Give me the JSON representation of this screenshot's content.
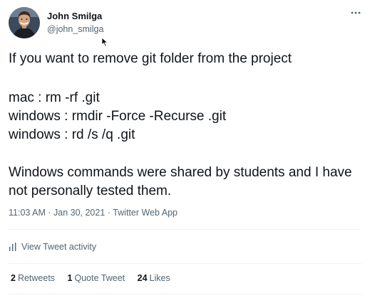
{
  "author": {
    "name": "John Smilga",
    "handle": "@john_smilga",
    "avatar_icon": "profile-photo-icon"
  },
  "tweet": {
    "lines": [
      "If you want to remove git folder from the project",
      "mac :  rm -rf .git",
      "windows :  rmdir -Force -Recurse .git",
      "windows : rd /s /q .git",
      "Windows commands were shared by students and I have",
      "not personally tested them."
    ]
  },
  "meta": {
    "time": "11:03 AM",
    "separator": " · ",
    "date": "Jan 30, 2021",
    "source": "Twitter Web App"
  },
  "activity": {
    "label": "View Tweet activity",
    "icon": "bar-chart-icon"
  },
  "stats": {
    "retweets_count": "2",
    "retweets_label": "Retweets",
    "quotes_count": "1",
    "quotes_label": "Quote Tweet",
    "likes_count": "24",
    "likes_label": "Likes"
  },
  "colors": {
    "text": "#0f1419",
    "secondary": "#536471",
    "divider": "#eff3f4"
  }
}
